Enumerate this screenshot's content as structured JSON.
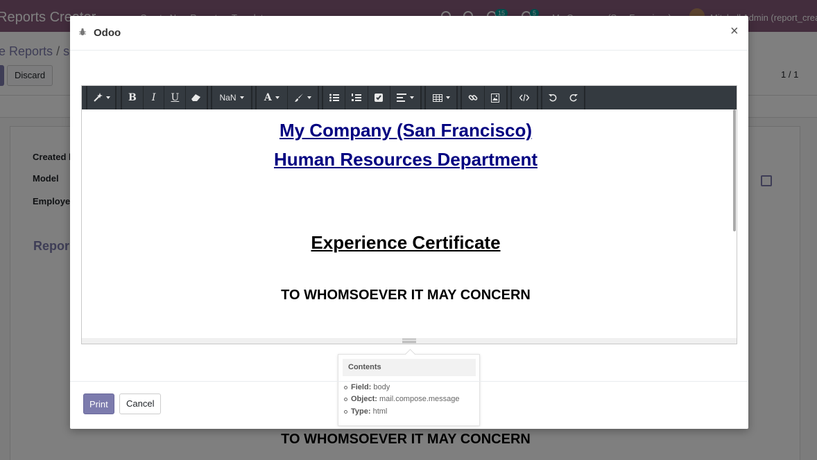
{
  "background": {
    "app_name": "Reports Creator",
    "menu": [
      "Create New Report",
      "Templates"
    ],
    "badge_activity": "15",
    "badge_messages": "5",
    "company_switcher": "My Company (San Francisco)",
    "user": "Mitchell Admin (report_crea",
    "breadcrumb_first": "e Reports",
    "breadcrumb_sep": "/",
    "breadcrumb_second": "s",
    "discard_label": "Discard",
    "pager": "1 / 1",
    "field_created": "Created b",
    "field_model": "Model",
    "field_employee": "Employe",
    "section_title": "Repor",
    "concern_text": "TO WHOMSOEVER IT MAY CONCERN"
  },
  "modal": {
    "title": "Odoo",
    "close_label": "×",
    "toolbar": {
      "font_size_label": "NaN"
    },
    "document": {
      "company_heading": "My Company (San Francisco)",
      "department_heading": "Human Resources Department",
      "certificate_heading": "Experience Certificate",
      "concern_line": "TO WHOMSOEVER IT MAY CONCERN"
    },
    "popover": {
      "title": "Contents",
      "items": [
        {
          "key": "Field:",
          "value": "body"
        },
        {
          "key": "Object:",
          "value": "mail.compose.message"
        },
        {
          "key": "Type:",
          "value": "html"
        }
      ]
    },
    "footer": {
      "print_label": "Print",
      "cancel_label": "Cancel"
    }
  },
  "colors": {
    "brand": "#875a7b",
    "primary_button": "#7c7bad",
    "heading_link": "#000080",
    "toolbar_bg": "#343a40"
  }
}
